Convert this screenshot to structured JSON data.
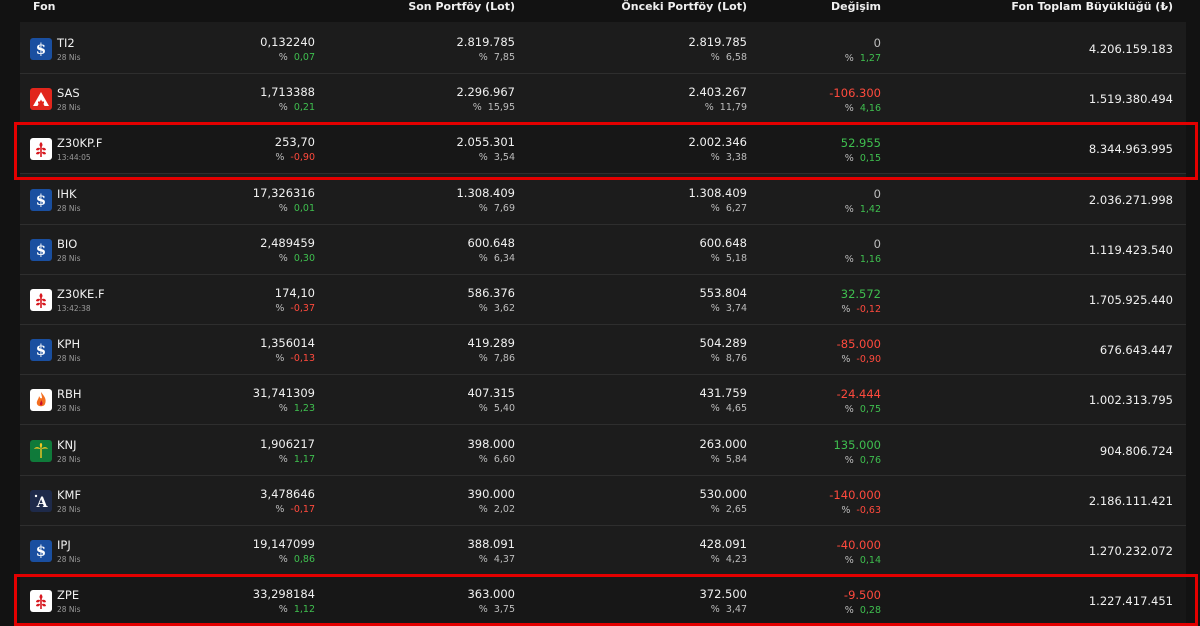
{
  "colors": {
    "positive": "#3fbf4f",
    "negative": "#ff4a3d",
    "neutral": "#bdbdbd",
    "highlight": "#e30000"
  },
  "headers": {
    "fon": "Fon",
    "son": "Son Portföy (Lot)",
    "onceki": "Önceki Portföy (Lot)",
    "degisim": "Değişim",
    "toplam": "Fon Toplam Büyüklüğü (₺)"
  },
  "rows": [
    {
      "code": "TI2",
      "date": "28 Nis",
      "icon": "isbank-icon",
      "price": "0,132240",
      "price_pct": "0,07",
      "price_dir": "pos",
      "son": "2.819.785",
      "son_pct": "7,85",
      "onceki": "2.819.785",
      "onceki_pct": "6,58",
      "chg": "0",
      "chg_dir": "neu",
      "chg_pct": "1,27",
      "chg_pct_dir": "pos",
      "total": "4.206.159.183",
      "highlight": false
    },
    {
      "code": "SAS",
      "date": "28 Nis",
      "icon": "akbank-icon",
      "price": "1,713388",
      "price_pct": "0,21",
      "price_dir": "pos",
      "son": "2.296.967",
      "son_pct": "15,95",
      "onceki": "2.403.267",
      "onceki_pct": "11,79",
      "chg": "-106.300",
      "chg_dir": "neg",
      "chg_pct": "4,16",
      "chg_pct_dir": "pos",
      "total": "1.519.380.494",
      "highlight": false
    },
    {
      "code": "Z30KP.F",
      "date": "13:44:05",
      "icon": "ziraat-icon",
      "price": "253,70",
      "price_pct": "-0,90",
      "price_dir": "neg",
      "son": "2.055.301",
      "son_pct": "3,54",
      "onceki": "2.002.346",
      "onceki_pct": "3,38",
      "chg": "52.955",
      "chg_dir": "pos",
      "chg_pct": "0,15",
      "chg_pct_dir": "pos",
      "total": "8.344.963.995",
      "highlight": true
    },
    {
      "code": "IHK",
      "date": "28 Nis",
      "icon": "isbank-icon",
      "price": "17,326316",
      "price_pct": "0,01",
      "price_dir": "pos",
      "son": "1.308.409",
      "son_pct": "7,69",
      "onceki": "1.308.409",
      "onceki_pct": "6,27",
      "chg": "0",
      "chg_dir": "neu",
      "chg_pct": "1,42",
      "chg_pct_dir": "pos",
      "total": "2.036.271.998",
      "highlight": false
    },
    {
      "code": "BIO",
      "date": "28 Nis",
      "icon": "isbank-icon",
      "price": "2,489459",
      "price_pct": "0,30",
      "price_dir": "pos",
      "son": "600.648",
      "son_pct": "6,34",
      "onceki": "600.648",
      "onceki_pct": "5,18",
      "chg": "0",
      "chg_dir": "neu",
      "chg_pct": "1,16",
      "chg_pct_dir": "pos",
      "total": "1.119.423.540",
      "highlight": false
    },
    {
      "code": "Z30KE.F",
      "date": "13:42:38",
      "icon": "ziraat-icon",
      "price": "174,10",
      "price_pct": "-0,37",
      "price_dir": "neg",
      "son": "586.376",
      "son_pct": "3,62",
      "onceki": "553.804",
      "onceki_pct": "3,74",
      "chg": "32.572",
      "chg_dir": "pos",
      "chg_pct": "-0,12",
      "chg_pct_dir": "neg",
      "total": "1.705.925.440",
      "highlight": false
    },
    {
      "code": "KPH",
      "date": "28 Nis",
      "icon": "isbank-icon",
      "price": "1,356014",
      "price_pct": "-0,13",
      "price_dir": "neg",
      "son": "419.289",
      "son_pct": "7,86",
      "onceki": "504.289",
      "onceki_pct": "8,76",
      "chg": "-85.000",
      "chg_dir": "neg",
      "chg_pct": "-0,90",
      "chg_pct_dir": "neg",
      "total": "676.643.447",
      "highlight": false
    },
    {
      "code": "RBH",
      "date": "28 Nis",
      "icon": "flame-icon",
      "price": "31,741309",
      "price_pct": "1,23",
      "price_dir": "pos",
      "son": "407.315",
      "son_pct": "5,40",
      "onceki": "431.759",
      "onceki_pct": "4,65",
      "chg": "-24.444",
      "chg_dir": "neg",
      "chg_pct": "0,75",
      "chg_pct_dir": "pos",
      "total": "1.002.313.795",
      "highlight": false
    },
    {
      "code": "KNJ",
      "date": "28 Nis",
      "icon": "palm-icon",
      "price": "1,906217",
      "price_pct": "1,17",
      "price_dir": "pos",
      "son": "398.000",
      "son_pct": "6,60",
      "onceki": "263.000",
      "onceki_pct": "5,84",
      "chg": "135.000",
      "chg_dir": "pos",
      "chg_pct": "0,76",
      "chg_pct_dir": "pos",
      "total": "904.806.724",
      "highlight": false
    },
    {
      "code": "KMF",
      "date": "28 Nis",
      "icon": "letter-a-icon",
      "price": "3,478646",
      "price_pct": "-0,17",
      "price_dir": "neg",
      "son": "390.000",
      "son_pct": "2,02",
      "onceki": "530.000",
      "onceki_pct": "2,65",
      "chg": "-140.000",
      "chg_dir": "neg",
      "chg_pct": "-0,63",
      "chg_pct_dir": "neg",
      "total": "2.186.111.421",
      "highlight": false
    },
    {
      "code": "IPJ",
      "date": "28 Nis",
      "icon": "isbank-icon",
      "price": "19,147099",
      "price_pct": "0,86",
      "price_dir": "pos",
      "son": "388.091",
      "son_pct": "4,37",
      "onceki": "428.091",
      "onceki_pct": "4,23",
      "chg": "-40.000",
      "chg_dir": "neg",
      "chg_pct": "0,14",
      "chg_pct_dir": "pos",
      "total": "1.270.232.072",
      "highlight": false
    },
    {
      "code": "ZPE",
      "date": "28 Nis",
      "icon": "ziraat-icon",
      "price": "33,298184",
      "price_pct": "1,12",
      "price_dir": "pos",
      "son": "363.000",
      "son_pct": "3,75",
      "onceki": "372.500",
      "onceki_pct": "3,47",
      "chg": "-9.500",
      "chg_dir": "neg",
      "chg_pct": "0,28",
      "chg_pct_dir": "pos",
      "total": "1.227.417.451",
      "highlight": true
    }
  ]
}
